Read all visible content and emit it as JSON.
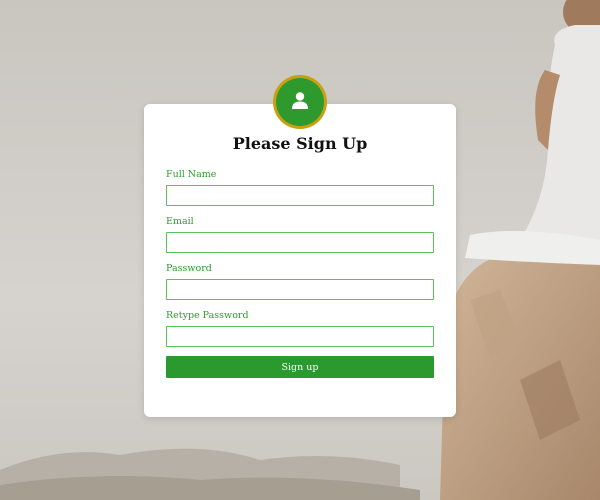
{
  "form": {
    "title": "Please Sign Up",
    "fields": [
      {
        "label": "Full Name",
        "value": "",
        "placeholder": ""
      },
      {
        "label": "Email",
        "value": "",
        "placeholder": ""
      },
      {
        "label": "Password",
        "value": "",
        "placeholder": ""
      },
      {
        "label": "Retype Password",
        "value": "",
        "placeholder": ""
      }
    ],
    "submit_label": "Sign up"
  },
  "icons": {
    "avatar": "user-icon"
  },
  "colors": {
    "accent": "#2e9a2e",
    "avatar_ring": "#c8a010",
    "card_bg": "#ffffff"
  }
}
